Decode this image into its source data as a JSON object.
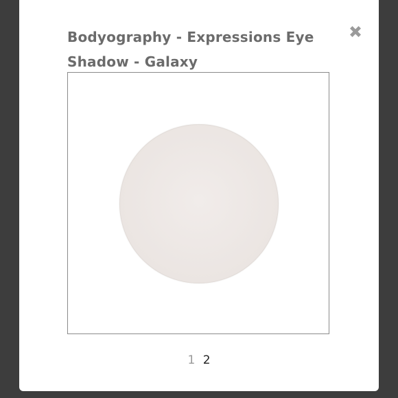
{
  "modal": {
    "title": "Bodyography - Expressions Eye Shadow - Galaxy",
    "close_icon": "close-x-icon",
    "image": {
      "alt": "Expressions Eye Shadow - Galaxy swatch",
      "swatch_color": "#ece6e3"
    },
    "pagination": {
      "pages": [
        {
          "label": "1",
          "current": false
        },
        {
          "label": "2",
          "current": true
        }
      ]
    }
  },
  "colors": {
    "backdrop": "#3d3d3d",
    "modal_bg": "#ffffff",
    "title_text": "#6b6b6b",
    "close_icon": "#9a9a9a",
    "frame_border": "#8a8a8a"
  }
}
